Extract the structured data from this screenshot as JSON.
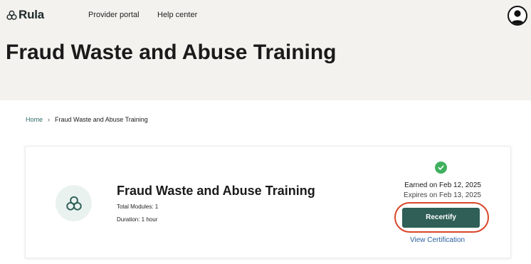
{
  "header": {
    "logo_text": "Rula",
    "nav": {
      "provider_portal": "Provider portal",
      "help_center": "Help center"
    },
    "page_title": "Fraud Waste and Abuse Training"
  },
  "breadcrumb": {
    "home": "Home",
    "separator": "›",
    "current": "Fraud Waste and Abuse Training"
  },
  "course": {
    "title": "Fraud Waste and Abuse Training",
    "total_modules": "Total Modules: 1",
    "duration": "Duration: 1 hour",
    "icon": "rula-knot-icon"
  },
  "certification": {
    "status_icon": "check-circle-icon",
    "earned": "Earned on Feb 12, 2025",
    "expires": "Expires on Feb 13, 2025",
    "recertify_label": "Recertify",
    "view_label": "View Certification"
  },
  "colors": {
    "hero_background": "#f4f2ee",
    "primary_button": "#2f5f57",
    "highlight_outline": "#d9462a",
    "link": "#2b5f9e",
    "success": "#3fb05e"
  }
}
